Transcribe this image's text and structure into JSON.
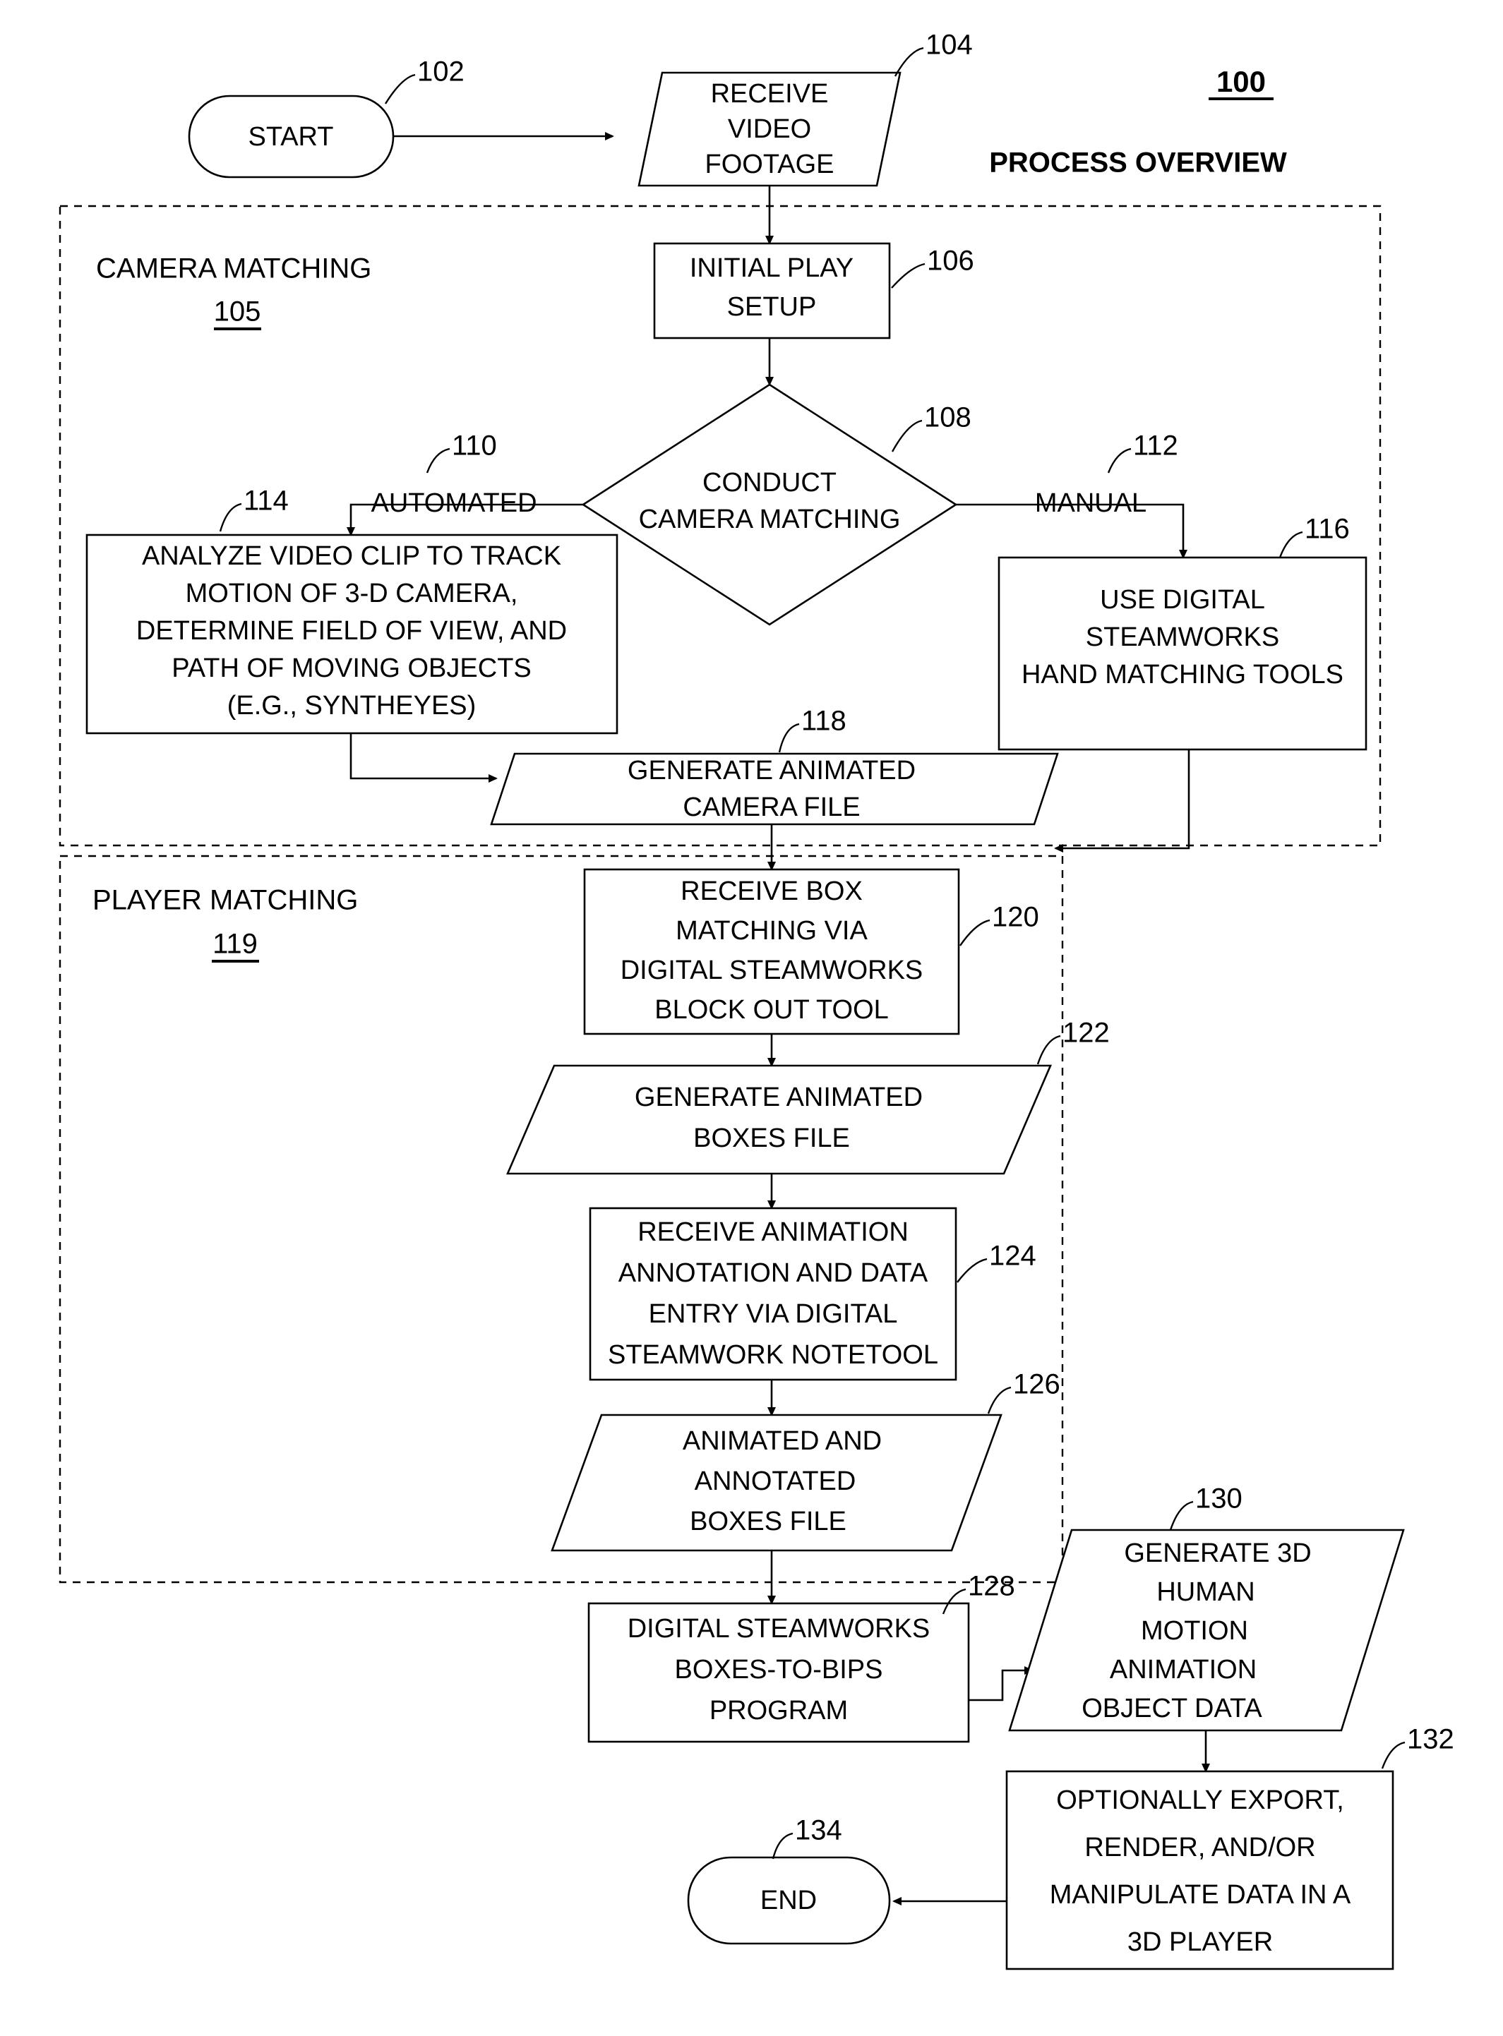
{
  "figure": {
    "number": "100",
    "title": "PROCESS OVERVIEW"
  },
  "groups": [
    {
      "id": "camera-matching",
      "title": "CAMERA MATCHING",
      "ref": "105"
    },
    {
      "id": "player-matching",
      "title": "PLAYER MATCHING",
      "ref": "119"
    }
  ],
  "branches": [
    {
      "id": "automated",
      "label": "AUTOMATED",
      "ref": "110"
    },
    {
      "id": "manual",
      "label": "MANUAL",
      "ref": "112"
    }
  ],
  "nodes": [
    {
      "id": "start",
      "ref": "102",
      "shape": "terminator",
      "lines": [
        "START"
      ]
    },
    {
      "id": "receive-video-footage",
      "ref": "104",
      "shape": "parallelogram",
      "lines": [
        "RECEIVE",
        "VIDEO",
        "FOOTAGE"
      ]
    },
    {
      "id": "initial-play-setup",
      "ref": "106",
      "shape": "process",
      "lines": [
        "INITIAL PLAY",
        "SETUP"
      ]
    },
    {
      "id": "conduct-camera-matching",
      "ref": "108",
      "shape": "decision",
      "lines": [
        "CONDUCT",
        "CAMERA MATCHING"
      ]
    },
    {
      "id": "analyze-video-clip",
      "ref": "114",
      "shape": "process",
      "lines": [
        "ANALYZE VIDEO CLIP TO TRACK",
        "MOTION OF 3-D CAMERA,",
        "DETERMINE FIELD OF VIEW, AND",
        "PATH OF MOVING OBJECTS",
        "(E.G., SYNTHEYES)"
      ]
    },
    {
      "id": "use-digital-steamworks-hand-matching-tools",
      "ref": "116",
      "shape": "process",
      "lines": [
        "USE DIGITAL",
        "STEAMWORKS",
        "HAND MATCHING TOOLS"
      ]
    },
    {
      "id": "generate-animated-camera-file",
      "ref": "118",
      "shape": "parallelogram",
      "lines": [
        "GENERATE ANIMATED",
        "CAMERA FILE"
      ]
    },
    {
      "id": "receive-box-matching",
      "ref": "120",
      "shape": "process",
      "lines": [
        "RECEIVE BOX",
        "MATCHING VIA",
        "DIGITAL STEAMWORKS",
        "BLOCK OUT TOOL"
      ]
    },
    {
      "id": "generate-animated-boxes-file",
      "ref": "122",
      "shape": "parallelogram",
      "lines": [
        "GENERATE ANIMATED",
        "BOXES FILE"
      ]
    },
    {
      "id": "receive-animation-annotation",
      "ref": "124",
      "shape": "process",
      "lines": [
        "RECEIVE ANIMATION",
        "ANNOTATION AND DATA",
        "ENTRY VIA DIGITAL",
        "STEAMWORK NOTETOOL"
      ]
    },
    {
      "id": "animated-annotated-boxes-file",
      "ref": "126",
      "shape": "parallelogram",
      "lines": [
        "ANIMATED AND",
        "ANNOTATED",
        "BOXES FILE"
      ]
    },
    {
      "id": "boxes-to-bips-program",
      "ref": "128",
      "shape": "process",
      "lines": [
        "DIGITAL STEAMWORKS",
        "BOXES-TO-BIPS",
        "PROGRAM"
      ]
    },
    {
      "id": "generate-3d-human-motion",
      "ref": "130",
      "shape": "parallelogram",
      "lines": [
        "GENERATE 3D",
        "HUMAN",
        "MOTION",
        "ANIMATION",
        "OBJECT DATA"
      ]
    },
    {
      "id": "optionally-export-render",
      "ref": "132",
      "shape": "process",
      "lines": [
        "OPTIONALLY EXPORT,",
        "RENDER, AND/OR",
        "MANIPULATE DATA IN A",
        "3D PLAYER"
      ]
    },
    {
      "id": "end",
      "ref": "134",
      "shape": "terminator",
      "lines": [
        "END"
      ]
    }
  ],
  "colors": {
    "stroke": "#000000",
    "background": "#ffffff"
  }
}
